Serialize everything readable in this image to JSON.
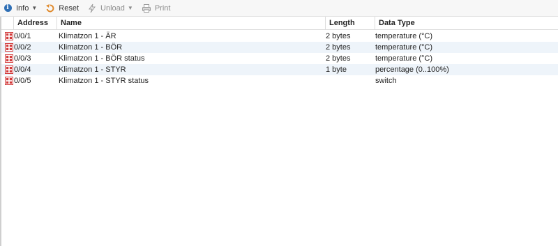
{
  "toolbar": {
    "info_label": "Info",
    "reset_label": "Reset",
    "unload_label": "Unload",
    "print_label": "Print"
  },
  "table": {
    "columns": [
      "Address",
      "Name",
      "Length",
      "Data Type"
    ],
    "rows": [
      {
        "address": "0/0/1",
        "name": "Klimatzon 1 - ÄR",
        "length": "2 bytes",
        "data_type": "temperature (°C)"
      },
      {
        "address": "0/0/2",
        "name": "Klimatzon 1 - BÖR",
        "length": "2 bytes",
        "data_type": "temperature (°C)"
      },
      {
        "address": "0/0/3",
        "name": "Klimatzon 1 - BÖR status",
        "length": "2 bytes",
        "data_type": "temperature (°C)"
      },
      {
        "address": "0/0/4",
        "name": "Klimatzon 1 - STYR",
        "length": "1 byte",
        "data_type": "percentage (0..100%)"
      },
      {
        "address": "0/0/5",
        "name": "Klimatzon 1 - STYR status",
        "length": "",
        "data_type": "switch"
      }
    ]
  },
  "colors": {
    "info_icon": "#2f6fb5",
    "reset_icon": "#e08a2c",
    "group_object_icon": "#d23a3a",
    "row_alt": "#eef4fa"
  },
  "icons": {
    "info": "info-icon",
    "reset": "reset-icon",
    "unload": "unload-icon",
    "print": "print-icon",
    "row": "group-address-icon"
  }
}
